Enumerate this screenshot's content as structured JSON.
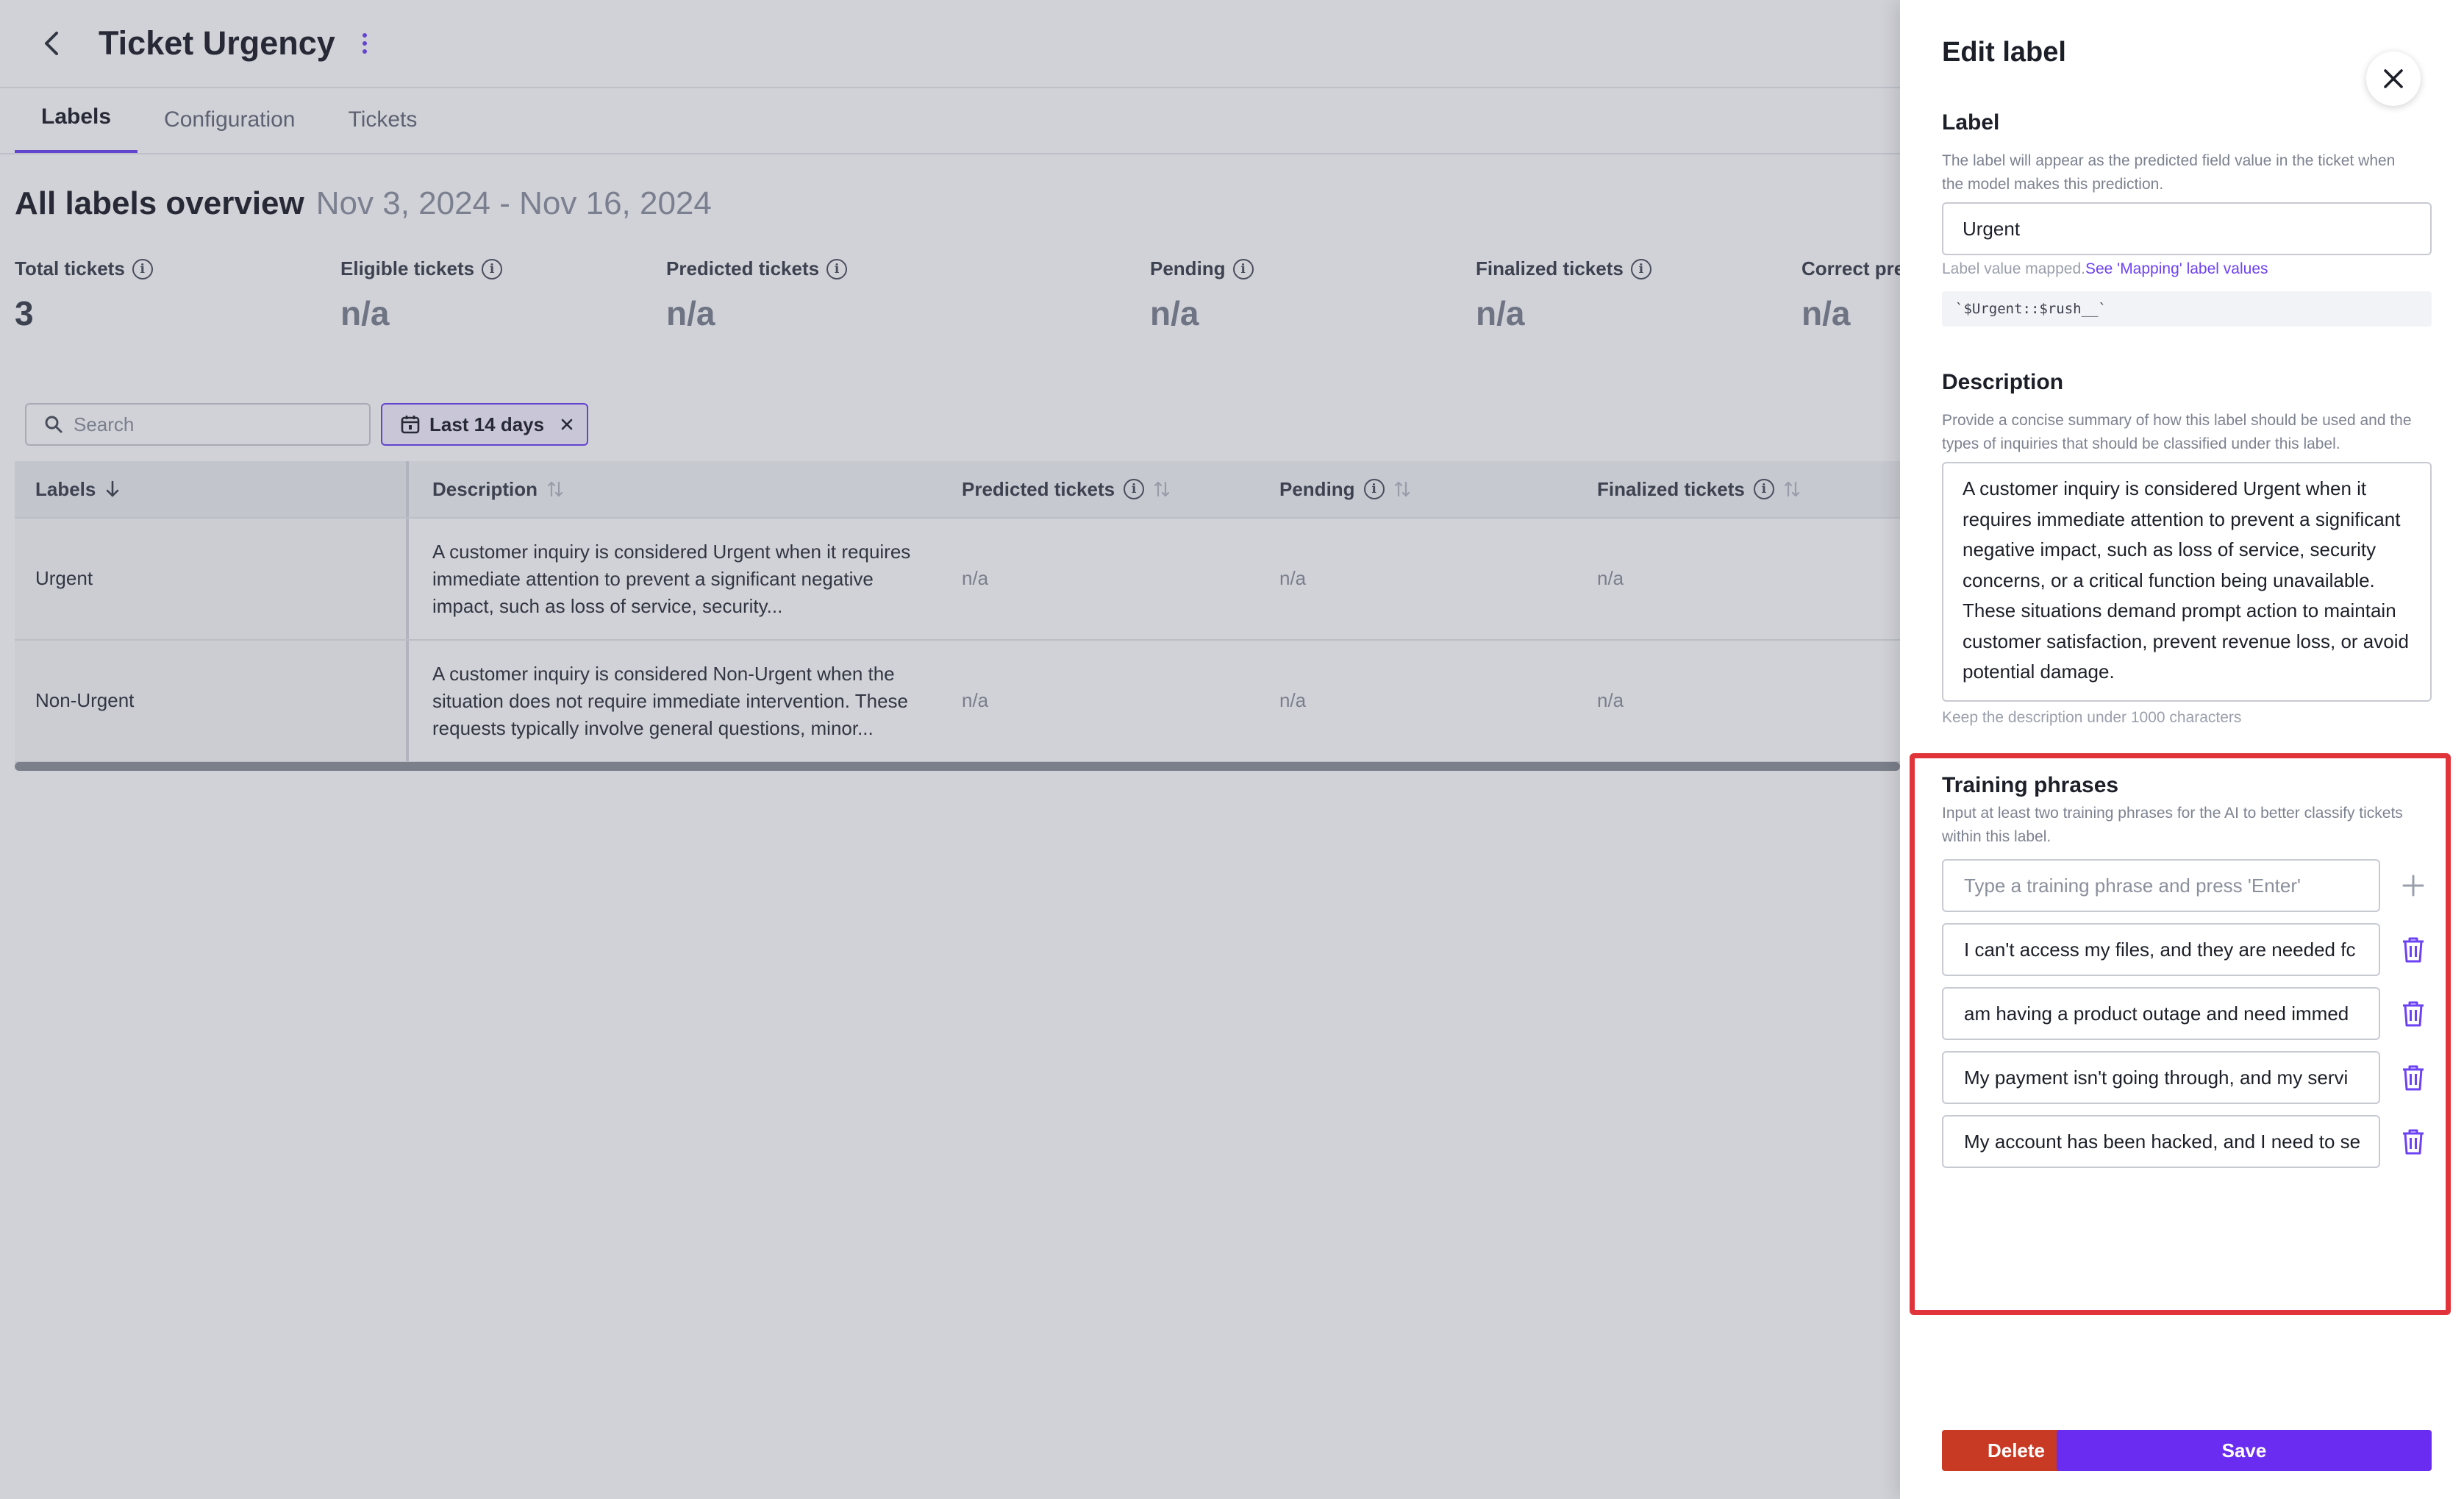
{
  "header": {
    "title": "Ticket Urgency"
  },
  "tabs": [
    {
      "label": "Labels",
      "active": true
    },
    {
      "label": "Configuration",
      "active": false
    },
    {
      "label": "Tickets",
      "active": false
    }
  ],
  "overview": {
    "heading": "All labels overview",
    "date_range": "Nov 3, 2024 - Nov 16, 2024"
  },
  "stats": [
    {
      "label": "Total tickets",
      "value": "3"
    },
    {
      "label": "Eligible tickets",
      "value": "n/a"
    },
    {
      "label": "Predicted tickets",
      "value": "n/a"
    },
    {
      "label": "Pending",
      "value": "n/a"
    },
    {
      "label": "Finalized tickets",
      "value": "n/a"
    },
    {
      "label": "Correct pre",
      "value": "n/a"
    }
  ],
  "filters": {
    "search_placeholder": "Search",
    "date_chip": "Last 14 days"
  },
  "table": {
    "columns": [
      "Labels",
      "Description",
      "Predicted tickets",
      "Pending",
      "Finalized tickets"
    ],
    "rows": [
      {
        "label": "Urgent",
        "description": "A customer inquiry is considered Urgent when it requires immediate attention to prevent a significant negative impact, such as loss of service, security...",
        "predicted": "n/a",
        "pending": "n/a",
        "finalized": "n/a"
      },
      {
        "label": "Non-Urgent",
        "description": "A customer inquiry is considered Non-Urgent when the situation does not require immediate intervention. These requests typically involve general questions, minor...",
        "predicted": "n/a",
        "pending": "n/a",
        "finalized": "n/a"
      }
    ]
  },
  "panel": {
    "title": "Edit label",
    "label_section": {
      "title": "Label",
      "help": "The label will appear as the predicted field value in the ticket when the model makes this prediction.",
      "value": "Urgent",
      "mapped_text": "Label value mapped.",
      "mapped_link": "See 'Mapping' label values",
      "code": "`$Urgent::$rush__`"
    },
    "description_section": {
      "title": "Description",
      "help": "Provide a concise summary of how this label should be used and the types of inquiries that should be classified under this label.",
      "value": "A customer inquiry is considered Urgent when it requires immediate attention to prevent a significant negative impact, such as loss of service, security concerns, or a critical function being unavailable. These situations demand prompt action to maintain customer satisfaction, prevent revenue loss, or avoid potential damage.",
      "note": "Keep the description under 1000 characters"
    },
    "training_section": {
      "title": "Training phrases",
      "help": "Input at least two training phrases for the AI to better classify tickets within this label.",
      "placeholder": "Type a training phrase and press 'Enter'",
      "phrases": [
        "I can't access my files, and they are needed fc",
        " am having a product outage and need immed",
        "My payment isn't going through, and my servi",
        "My account has been hacked, and I need to se"
      ]
    },
    "buttons": {
      "delete": "Delete",
      "save": "Save"
    }
  },
  "colors": {
    "accent": "#6d42f5",
    "danger": "#c93a25",
    "highlight": "#e0343a"
  }
}
